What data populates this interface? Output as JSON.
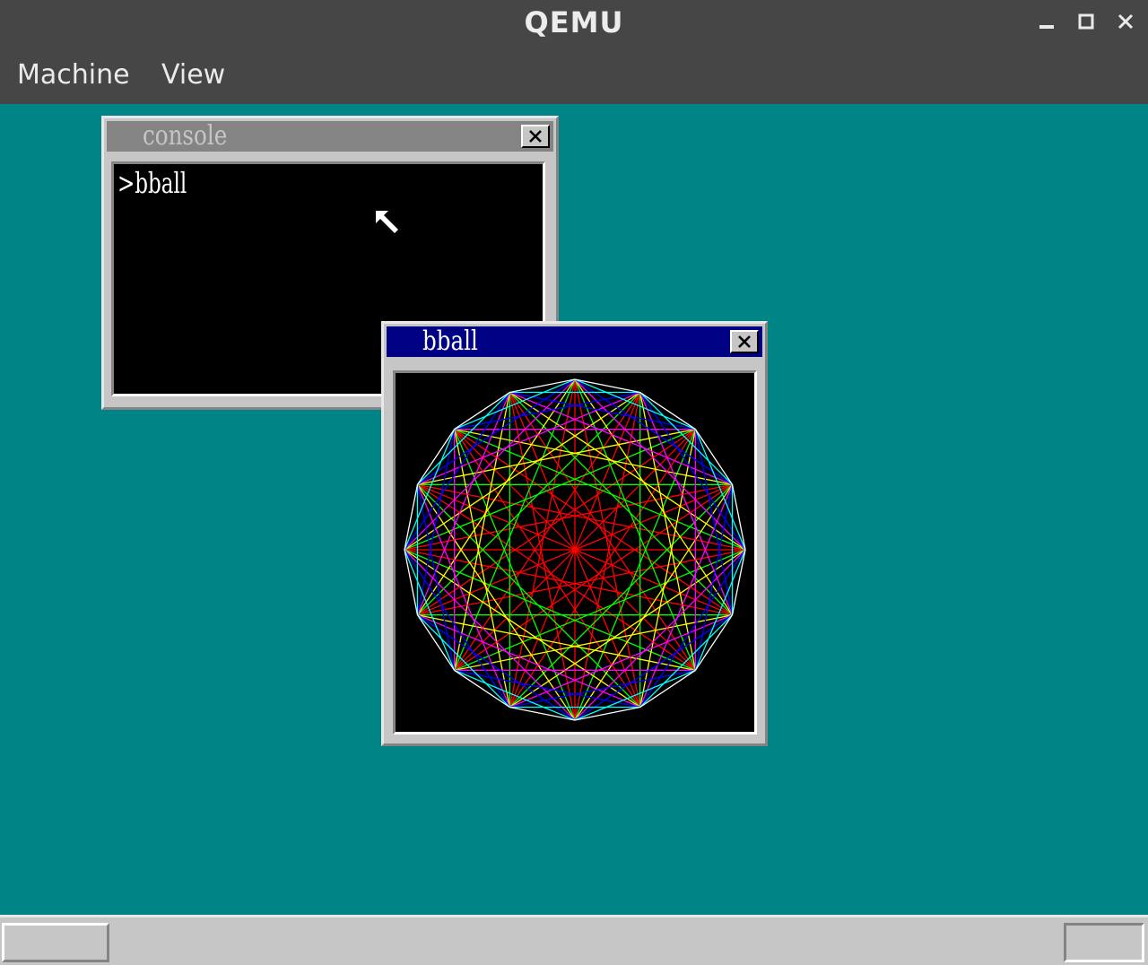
{
  "host_window": {
    "title": "QEMU",
    "controls": [
      "minimize-icon",
      "maximize-icon",
      "close-icon"
    ]
  },
  "menu": {
    "items": [
      {
        "label": "Machine"
      },
      {
        "label": "View"
      }
    ]
  },
  "colors": {
    "desktop": "#008486",
    "active_title": "#000084",
    "inactive_title": "#848484",
    "window_face": "#c6c6c6"
  },
  "console_window": {
    "title": "console",
    "active": false,
    "lines": [
      ">bball"
    ]
  },
  "bball_window": {
    "title": "bball",
    "active": true,
    "drawing": {
      "points": 16,
      "line_colors": [
        "#ffffff",
        "#00ffff",
        "#0000ff",
        "#ff00ff",
        "#ffff00",
        "#00ff00",
        "#ff0000"
      ]
    }
  },
  "taskbar": {
    "start_button": "",
    "tray": ""
  }
}
